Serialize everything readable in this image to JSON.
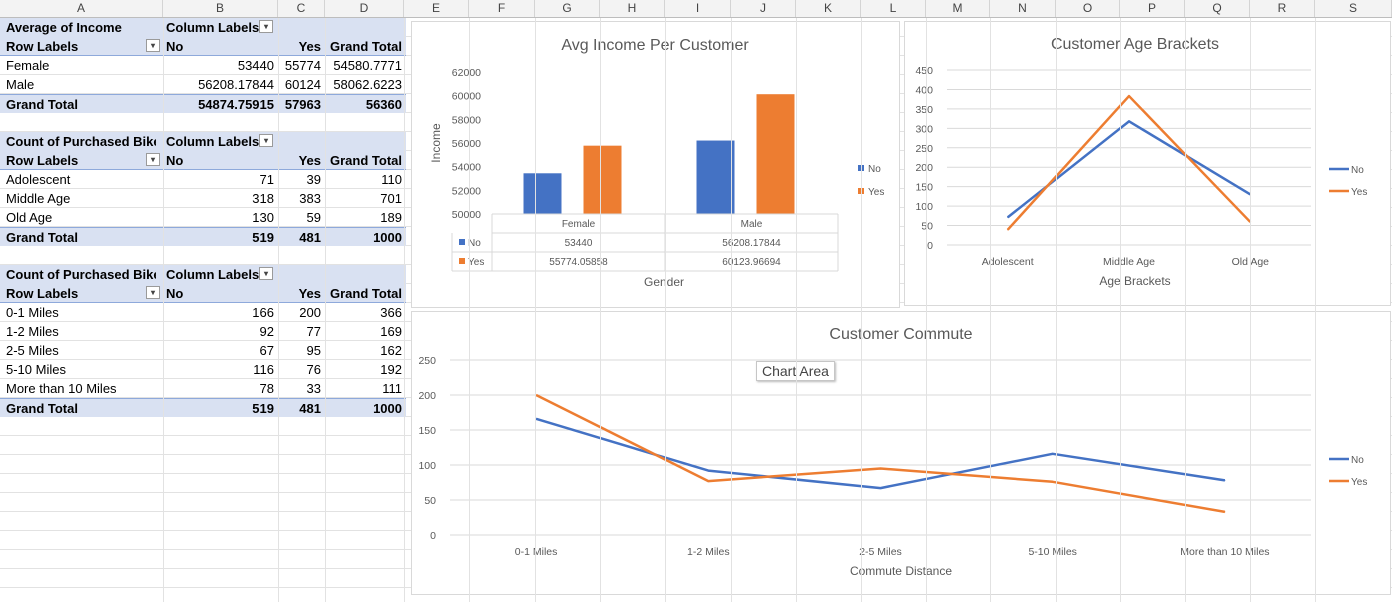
{
  "columns": [
    "A",
    "B",
    "C",
    "D",
    "E",
    "F",
    "G",
    "H",
    "I",
    "J",
    "K",
    "L",
    "M",
    "N",
    "O",
    "P",
    "Q",
    "R",
    "S"
  ],
  "pivot1": {
    "corner": "Average of Income",
    "col_labels": "Column Labels",
    "row_labels": "Row Labels",
    "h_no": "No",
    "h_yes": "Yes",
    "h_total": "Grand Total",
    "rows": [
      {
        "label": "Female",
        "no": "53440",
        "yes": "55774",
        "total": "54580.7771"
      },
      {
        "label": "Male",
        "no": "56208.17844",
        "yes": "60124",
        "total": "58062.6223"
      }
    ],
    "grand": {
      "label": "Grand Total",
      "no": "54874.75915",
      "yes": "57963",
      "total": "56360"
    }
  },
  "pivot2": {
    "corner": "Count of Purchased Bike",
    "col_labels": "Column Labels",
    "row_labels": "Row Labels",
    "h_no": "No",
    "h_yes": "Yes",
    "h_total": "Grand Total",
    "rows": [
      {
        "label": "Adolescent",
        "no": "71",
        "yes": "39",
        "total": "110"
      },
      {
        "label": "Middle Age",
        "no": "318",
        "yes": "383",
        "total": "701"
      },
      {
        "label": "Old Age",
        "no": "130",
        "yes": "59",
        "total": "189"
      }
    ],
    "grand": {
      "label": "Grand Total",
      "no": "519",
      "yes": "481",
      "total": "1000"
    }
  },
  "pivot3": {
    "corner": "Count of Purchased Bike",
    "col_labels": "Column Labels",
    "row_labels": "Row Labels",
    "h_no": "No",
    "h_yes": "Yes",
    "h_total": "Grand Total",
    "rows": [
      {
        "label": "0-1 Miles",
        "no": "166",
        "yes": "200",
        "total": "366"
      },
      {
        "label": "1-2 Miles",
        "no": "92",
        "yes": "77",
        "total": "169"
      },
      {
        "label": "2-5 Miles",
        "no": "67",
        "yes": "95",
        "total": "162"
      },
      {
        "label": "5-10 Miles",
        "no": "116",
        "yes": "76",
        "total": "192"
      },
      {
        "label": "More than 10 Miles",
        "no": "78",
        "yes": "33",
        "total": "111"
      }
    ],
    "grand": {
      "label": "Grand Total",
      "no": "519",
      "yes": "481",
      "total": "1000"
    }
  },
  "tooltip": "Chart Area",
  "colors": {
    "no": "#4472c4",
    "yes": "#ed7d31",
    "band": "#d9e1f2"
  },
  "chart_data": [
    {
      "type": "bar",
      "title": "Avg Income Per Customer",
      "xlabel": "Gender",
      "ylabel": "Income",
      "categories": [
        "Female",
        "Male"
      ],
      "series": [
        {
          "name": "No",
          "values": [
            53440,
            56208.17844
          ],
          "labels": [
            "53440",
            "56208.17844"
          ]
        },
        {
          "name": "Yes",
          "values": [
            55774.05858,
            60123.96694
          ],
          "labels": [
            "55774.05858",
            "60123.96694"
          ]
        }
      ],
      "ylim": [
        50000,
        62000
      ],
      "yticks": [
        "50000",
        "52000",
        "54000",
        "56000",
        "58000",
        "60000",
        "62000"
      ],
      "legend": "right",
      "data_table": true
    },
    {
      "type": "line",
      "title": "Customer Age Brackets",
      "xlabel": "Age Brackets",
      "ylabel": "",
      "categories": [
        "Adolescent",
        "Middle Age",
        "Old Age"
      ],
      "series": [
        {
          "name": "No",
          "values": [
            71,
            318,
            130
          ]
        },
        {
          "name": "Yes",
          "values": [
            39,
            383,
            59
          ]
        }
      ],
      "ylim": [
        0,
        450
      ],
      "yticks": [
        "0",
        "50",
        "100",
        "150",
        "200",
        "250",
        "300",
        "350",
        "400",
        "450"
      ],
      "legend": "right",
      "grid": true
    },
    {
      "type": "line",
      "title": "Customer Commute",
      "xlabel": "Commute Distance",
      "ylabel": "",
      "categories": [
        "0-1 Miles",
        "1-2 Miles",
        "2-5 Miles",
        "5-10 Miles",
        "More than 10 Miles"
      ],
      "series": [
        {
          "name": "No",
          "values": [
            166,
            92,
            67,
            116,
            78
          ]
        },
        {
          "name": "Yes",
          "values": [
            200,
            77,
            95,
            76,
            33
          ]
        }
      ],
      "ylim": [
        0,
        250
      ],
      "yticks": [
        "0",
        "50",
        "100",
        "150",
        "200",
        "250"
      ],
      "legend": "right",
      "grid": true
    }
  ]
}
